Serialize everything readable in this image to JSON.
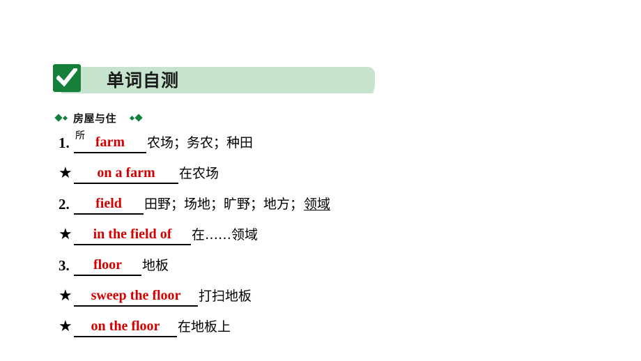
{
  "banner": {
    "icon": "checkmark-icon",
    "title": "单词自测",
    "bg_color": "#c6e3cd",
    "icon_color": "#15803a"
  },
  "section": {
    "label": "房屋与住",
    "diamond_color": "#12823b"
  },
  "answer_color": "#d40000",
  "entries": [
    {
      "marker": "1.",
      "marker_type": "number",
      "prefix": "所",
      "answer": "farm",
      "meaning": "农场；务农；种田",
      "meaning_underlined": ""
    },
    {
      "marker": "★",
      "marker_type": "star",
      "prefix": "",
      "answer": "on a farm",
      "meaning": "在农场",
      "meaning_underlined": ""
    },
    {
      "marker": "2.",
      "marker_type": "number",
      "prefix": "",
      "answer": "field",
      "meaning": "田野；场地；旷野；地方；",
      "meaning_underlined": "领域"
    },
    {
      "marker": "★",
      "marker_type": "star",
      "prefix": "",
      "answer": "in the field of",
      "meaning": "在……领域",
      "meaning_underlined": ""
    },
    {
      "marker": "3.",
      "marker_type": "number",
      "prefix": "",
      "answer": "floor",
      "meaning": "地板",
      "meaning_underlined": ""
    },
    {
      "marker": "★",
      "marker_type": "star",
      "prefix": "",
      "answer": "sweep the floor",
      "meaning": "打扫地板",
      "meaning_underlined": ""
    },
    {
      "marker": "★",
      "marker_type": "star",
      "prefix": "",
      "answer": "on the floor",
      "meaning": "在地板上",
      "meaning_underlined": ""
    }
  ]
}
